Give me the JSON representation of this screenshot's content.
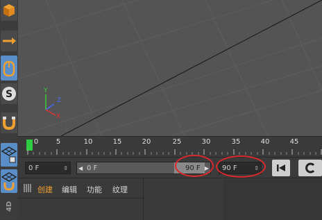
{
  "timeline": {
    "ticks": [
      "0",
      "5",
      "10",
      "15",
      "20",
      "25",
      "30",
      "35",
      "40",
      "45"
    ]
  },
  "controls": {
    "start_field": "0 F",
    "range_start": "0 F",
    "range_end": "90 F",
    "end_field": "90 F"
  },
  "menubar": {
    "items": [
      "创建",
      "编辑",
      "功能",
      "纹理"
    ]
  },
  "side_label": "4D",
  "axis": {
    "x": "X",
    "y": "Y",
    "z": "Z"
  },
  "colors": {
    "accent": "#5a8ec9",
    "timeline_marker": "#2ecc40",
    "highlight": "#d9292e"
  }
}
